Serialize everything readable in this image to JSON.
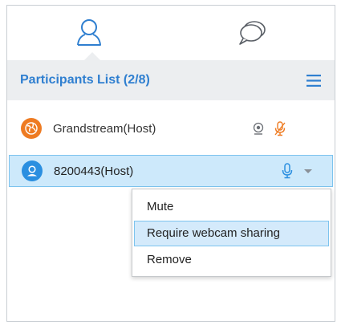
{
  "tabs": [
    {
      "icon": "user-icon",
      "active": true
    },
    {
      "icon": "chat-icon",
      "active": false
    }
  ],
  "header": {
    "title": "Participants List (2/8)",
    "menu_icon": "hamburger-menu-icon"
  },
  "participants": [
    {
      "name": "Grandstream(Host)",
      "avatar_icon": "globe-icon",
      "avatar_color": "#ee7b22",
      "webcam": true,
      "mic": "muted",
      "selected": false
    },
    {
      "name": "8200443(Host)",
      "avatar_icon": "user-icon",
      "avatar_color": "#2b8fe0",
      "webcam": false,
      "mic": "on",
      "selected": true
    }
  ],
  "context_menu": {
    "items": [
      "Mute",
      "Require webcam sharing",
      "Remove"
    ],
    "highlighted": "Require webcam sharing"
  },
  "colors": {
    "accent": "#2f7fd0",
    "selected_bg": "#cde9fb",
    "muted_mic": "#ee7b22"
  }
}
